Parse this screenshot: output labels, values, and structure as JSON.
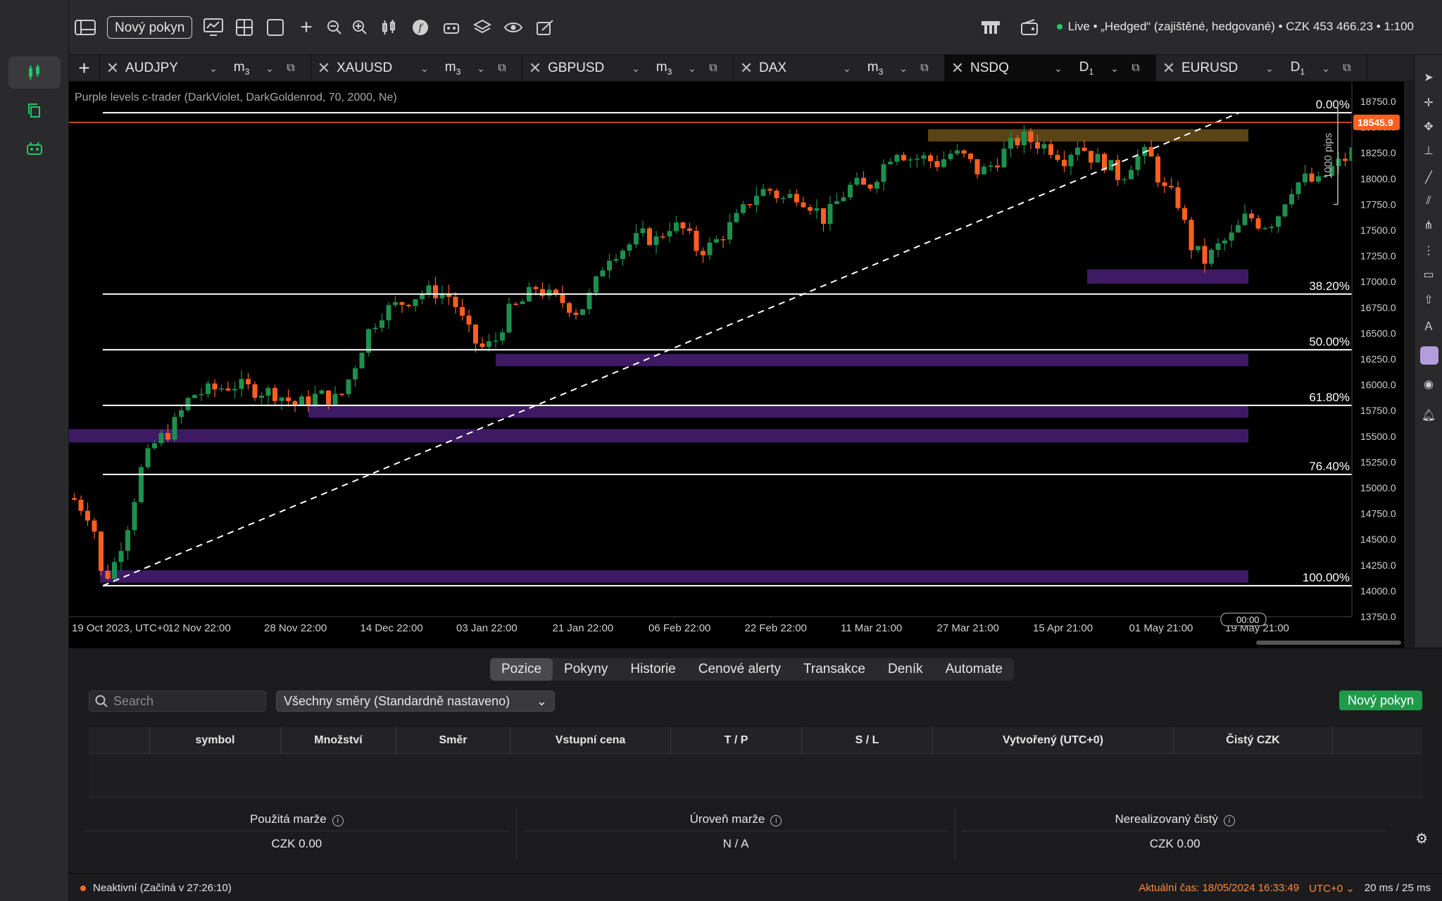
{
  "toolbar": {
    "new_order_label": "Nový pokyn",
    "account_text": "Live • „Hedged“ (zajištěné, hedgované) • CZK 453 466.23 • 1:100",
    "icons": [
      "layout-icon",
      "chart-monitor-icon",
      "grid-icon",
      "square-icon",
      "plus-icon",
      "zoom-out-icon",
      "zoom-in-icon",
      "candles-icon",
      "function-icon",
      "robot-icon",
      "layers-icon",
      "eye-icon",
      "edit-icon"
    ]
  },
  "tabs": [
    {
      "symbol": "AUDJPY",
      "timeframe": "m",
      "tf_sub": "3"
    },
    {
      "symbol": "XAUUSD",
      "timeframe": "m",
      "tf_sub": "3"
    },
    {
      "symbol": "GBPUSD",
      "timeframe": "m",
      "tf_sub": "3"
    },
    {
      "symbol": "DAX",
      "timeframe": "m",
      "tf_sub": "3"
    },
    {
      "symbol": "NSDQ",
      "timeframe": "D",
      "tf_sub": "1",
      "active": true
    },
    {
      "symbol": "EURUSD",
      "timeframe": "D",
      "tf_sub": "1"
    }
  ],
  "chart": {
    "indicator_label": "Purple levels c-trader (DarkViolet, DarkGoldenrod, 70, 2000, Ne)",
    "price_axis": [
      "18750.0",
      "18500.0",
      "18250.0",
      "18000.0",
      "17750.0",
      "17500.0",
      "17250.0",
      "17000.0",
      "16750.0",
      "16500.0",
      "16250.0",
      "16000.0",
      "15750.0",
      "15500.0",
      "15250.0",
      "15000.0",
      "14750.0",
      "14500.0",
      "14250.0",
      "14000.0",
      "13750.0"
    ],
    "time_axis": [
      "19 Oct 2023, UTC+0",
      "12 Nov 22:00",
      "28 Nov 22:00",
      "14 Dec 22:00",
      "03 Jan 22:00",
      "21 Jan 22:00",
      "06 Feb 22:00",
      "22 Feb 22:00",
      "11 Mar 21:00",
      "27 Mar 21:00",
      "15 Apr 21:00",
      "01 May 21:00",
      "19 May 21:00"
    ],
    "current_price": "18545.9",
    "countdown": "00:00",
    "range_label": "1000 pips",
    "fib_levels": [
      {
        "label": "0.00%",
        "price": 18640
      },
      {
        "label": "38.20%",
        "price": 16880
      },
      {
        "label": "50.00%",
        "price": 16340
      },
      {
        "label": "61.80%",
        "price": 15800
      },
      {
        "label": "76.40%",
        "price": 15130
      },
      {
        "label": "100.00%",
        "price": 14050
      }
    ],
    "colors": {
      "bull": "#1e8f4e",
      "bear": "#ff5f1f",
      "zone": "#3d1a63",
      "gold_zone": "#5a4314",
      "price_line": "#ff5f1f"
    }
  },
  "bottom": {
    "tabs": [
      "Pozice",
      "Pokyny",
      "Historie",
      "Cenové alerty",
      "Transakce",
      "Deník",
      "Automate"
    ],
    "search_placeholder": "Search",
    "direction_select": "Všechny směry (Standardně nastaveno)",
    "new_order_label": "Nový pokyn",
    "columns": [
      "",
      "symbol",
      "Množství",
      "Směr",
      "Vstupní cena",
      "T / P",
      "S / L",
      "Vytvořený (UTC+0)",
      "Čistý CZK",
      ""
    ],
    "summary": [
      {
        "label": "Použitá marže",
        "value": "CZK 0.00"
      },
      {
        "label": "Úroveň marže",
        "value": "N / A"
      },
      {
        "label": "Nerealizovaný čistý",
        "value": "CZK 0.00"
      }
    ]
  },
  "status": {
    "session": "Neaktivní (Začíná v 27:26:10)",
    "time": "Aktuální čas: 18/05/2024 16:33:49",
    "tz": "UTC+0",
    "latency": "20 ms / 25 ms"
  }
}
